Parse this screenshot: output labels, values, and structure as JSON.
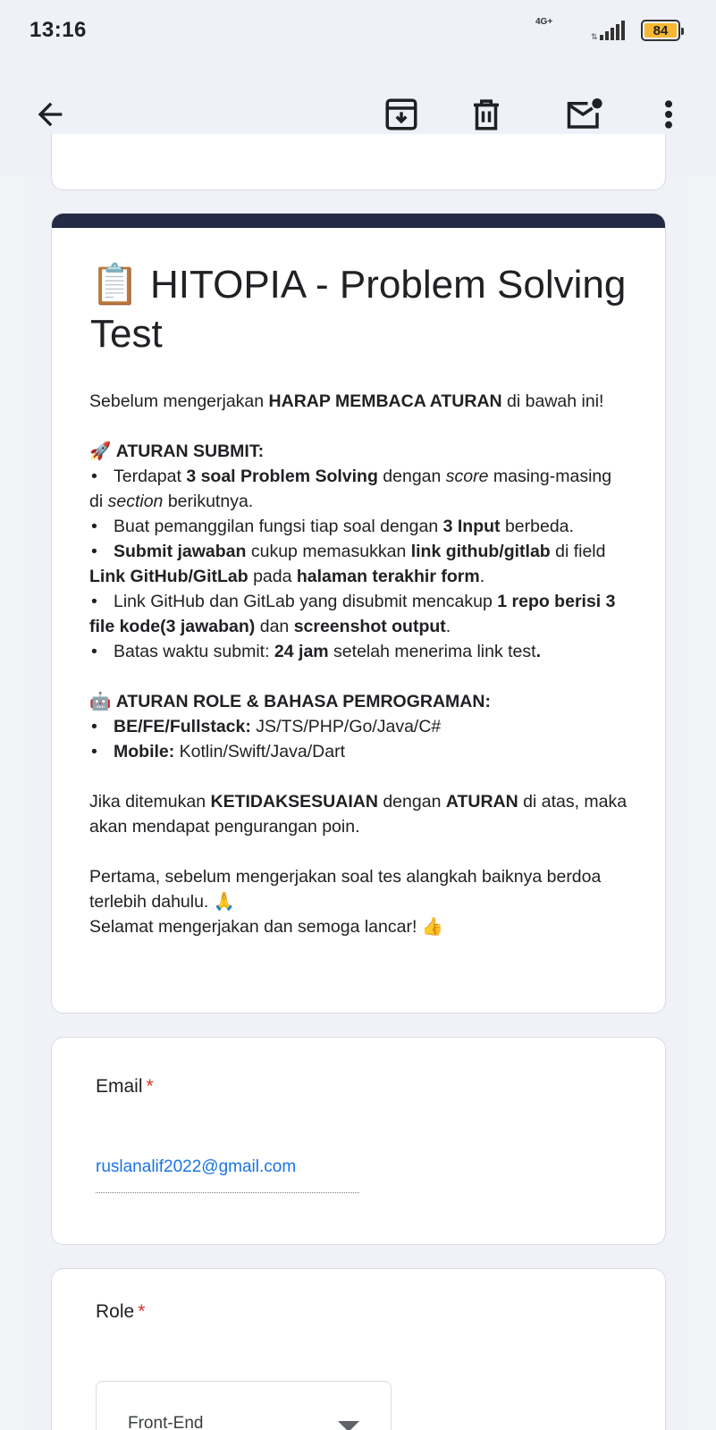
{
  "status_bar": {
    "time": "13:16",
    "network": "4G+",
    "battery": "84",
    "battery_color": "#f7b733"
  },
  "toolbar": {
    "back_icon": "arrow-back-icon",
    "archive_icon": "archive-icon",
    "delete_icon": "delete-icon",
    "mark_unread_icon": "mark-unread-icon",
    "more_icon": "more-vert-icon"
  },
  "form": {
    "accent_color": "#222a44",
    "title_emoji": "📋",
    "title": "HITOPIA - Problem Solving Test",
    "intro": {
      "before": "Sebelum mengerjakan ",
      "bold": "HARAP MEMBACA ATURAN",
      "after": " di bawah ini!"
    },
    "submit_heading_emoji": "🚀",
    "submit_heading": "ATURAN SUBMIT:",
    "submit_rules": {
      "r1_a": "Terdapat ",
      "r1_b": "3 soal Problem Solving",
      "r1_c": " dengan ",
      "r1_d": "score",
      "r1_e": " masing-masing di ",
      "r1_f": "section",
      "r1_g": " berikutnya.",
      "r2_a": "Buat pemanggilan fungsi tiap soal dengan ",
      "r2_b": "3 Input",
      "r2_c": " berbeda.",
      "r3_a": "Submit jawaban",
      "r3_b": " cukup memasukkan ",
      "r3_c": "link github/gitlab",
      "r3_d": " di field ",
      "r3_e": "Link GitHub/GitLab",
      "r3_f": " pada ",
      "r3_g": "halaman terakhir form",
      "r3_h": ".",
      "r4_a": "Link GitHub dan GitLab yang disubmit  mencakup ",
      "r4_b": "1 repo berisi 3 file kode(3 jawaban)",
      "r4_c": " dan ",
      "r4_d": "screenshot output",
      "r4_e": ".",
      "r5_a": "Batas waktu submit: ",
      "r5_b": "24 jam",
      "r5_c": " setelah menerima link test",
      "r5_d": "."
    },
    "role_heading_emoji": "🤖",
    "role_heading": "ATURAN ROLE & BAHASA PEMROGRAMAN:",
    "role_rules": {
      "be_label": "BE/FE/Fullstack:",
      "be_value": " JS/TS/PHP/Go/Java/C#",
      "mobile_label": "Mobile:",
      "mobile_value": " Kotlin/Swift/Java/Dart"
    },
    "warning": {
      "a": "Jika ditemukan ",
      "b": "KETIDAKSESUAIAN",
      "c": " dengan ",
      "d": "ATURAN",
      "e": " di atas, maka akan mendapat pengurangan poin."
    },
    "closing_1": "Pertama, sebelum mengerjakan soal tes alangkah baiknya berdoa terlebih dahulu. 🙏",
    "closing_2": "Selamat mengerjakan dan semoga lancar! 👍"
  },
  "email_question": {
    "label": "Email",
    "required_mark": "*",
    "value": "ruslanalif2022@gmail.com"
  },
  "role_question": {
    "label": "Role",
    "required_mark": "*",
    "selected": "Front-End"
  }
}
